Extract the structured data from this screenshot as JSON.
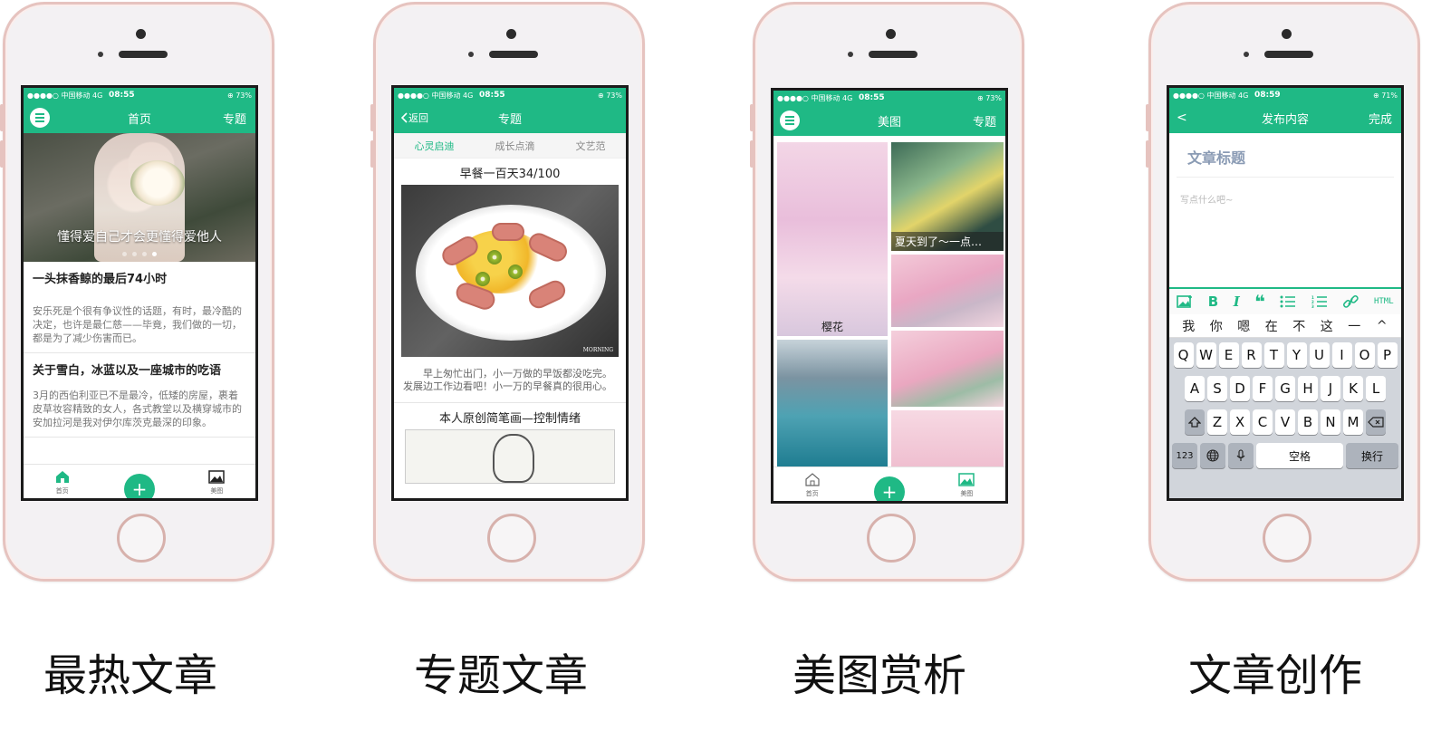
{
  "status_common": {
    "carrier": "●●●●○ 中国移动  4G",
    "battery_73": "⊕ 73%",
    "battery_71": "⊕ 71%"
  },
  "screen1": {
    "time": "08:55",
    "nav_title": "首页",
    "nav_right": "专题",
    "hero_caption": "懂得爱自己才会更懂得爱他人",
    "articles": [
      {
        "title": "一头抹香鲸的最后74小时",
        "body": "安乐死是个很有争议性的话题，有时，最冷酷的决定，也许是最仁慈——毕竟，我们做的一切，都是为了减少伤害而已。"
      },
      {
        "title": "关于雪白，冰蓝以及一座城市的吃语",
        "body": "3月的西伯利亚已不是最冷，低矮的房屋，裹着皮草妆容精致的女人，各式教堂以及横穿城市的安加拉河是我对伊尔库茨克最深的印象。"
      }
    ],
    "tabs": [
      "首页",
      "发布",
      "美图"
    ],
    "fab": "+"
  },
  "screen2": {
    "time": "08:55",
    "nav_back": "返回",
    "nav_title": "专题",
    "subtabs": [
      "心灵启迪",
      "成长点滴",
      "文艺范"
    ],
    "topic_title": "早餐一百天34/100",
    "image_watermark": "MORNING",
    "body": "早上匆忙出门，小一万做的早饭都没吃完。发展边工作边看吧！小一万的早餐真的很用心。",
    "topic2_title": "本人原创简笔画—控制情绪"
  },
  "screen3": {
    "time": "08:55",
    "nav_title": "美图",
    "nav_right": "专题",
    "label_sakura": "樱花",
    "label_summer": "夏天到了～一点…",
    "tabs": [
      "首页",
      "发布",
      "美图"
    ],
    "fab": "+"
  },
  "screen4": {
    "time": "08:59",
    "nav_back": "<",
    "nav_title": "发布内容",
    "nav_right": "完成",
    "title_placeholder": "文章标题",
    "body_placeholder": "写点什么吧~",
    "toolbar_html": "HTML",
    "candidates": [
      "我",
      "你",
      "嗯",
      "在",
      "不",
      "这",
      "一",
      "^"
    ],
    "row1": [
      "Q",
      "W",
      "E",
      "R",
      "T",
      "Y",
      "U",
      "I",
      "O",
      "P"
    ],
    "row2": [
      "A",
      "S",
      "D",
      "F",
      "G",
      "H",
      "J",
      "K",
      "L"
    ],
    "row3": [
      "Z",
      "X",
      "C",
      "V",
      "B",
      "N",
      "M"
    ],
    "key_123": "123",
    "key_space": "空格",
    "key_return": "换行"
  },
  "captions": [
    "最热文章",
    "专题文章",
    "美图赏析",
    "文章创作"
  ],
  "colors": {
    "accent": "#1fb985",
    "phone_frame": "#e6c3bf"
  }
}
